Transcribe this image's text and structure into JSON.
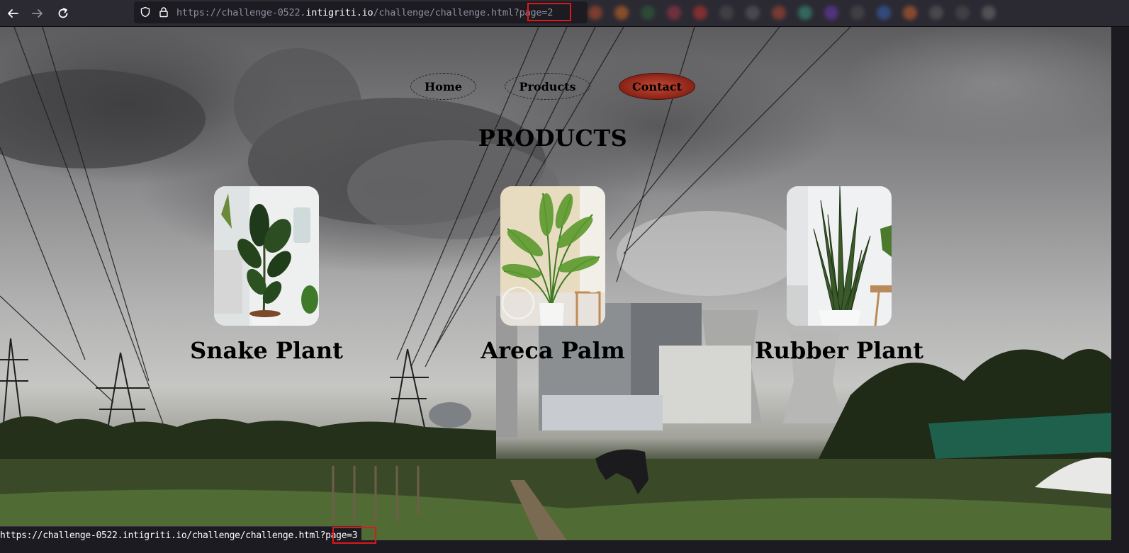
{
  "browser": {
    "url_prefix": "https://challenge-0522.",
    "url_host": "intigriti.io",
    "url_path": "/challenge/challenge.html",
    "url_query": "?page=2",
    "status_url": "https://challenge-0522.intigriti.io/challenge/challenge.html?page=3",
    "highlight_color": "#e0161b"
  },
  "nav": {
    "items": [
      {
        "label": "Home",
        "active": false
      },
      {
        "label": "Products",
        "active": false
      },
      {
        "label": "Contact",
        "active": true
      }
    ],
    "active_color": "#a0301f"
  },
  "page": {
    "heading": "PRODUCTS"
  },
  "products": [
    {
      "name": "Snake Plant",
      "image_icon": "rubber-plant-photo"
    },
    {
      "name": "Areca Palm",
      "image_icon": "areca-palm-photo"
    },
    {
      "name": "Rubber Plant",
      "image_icon": "snake-plant-photo"
    }
  ]
}
